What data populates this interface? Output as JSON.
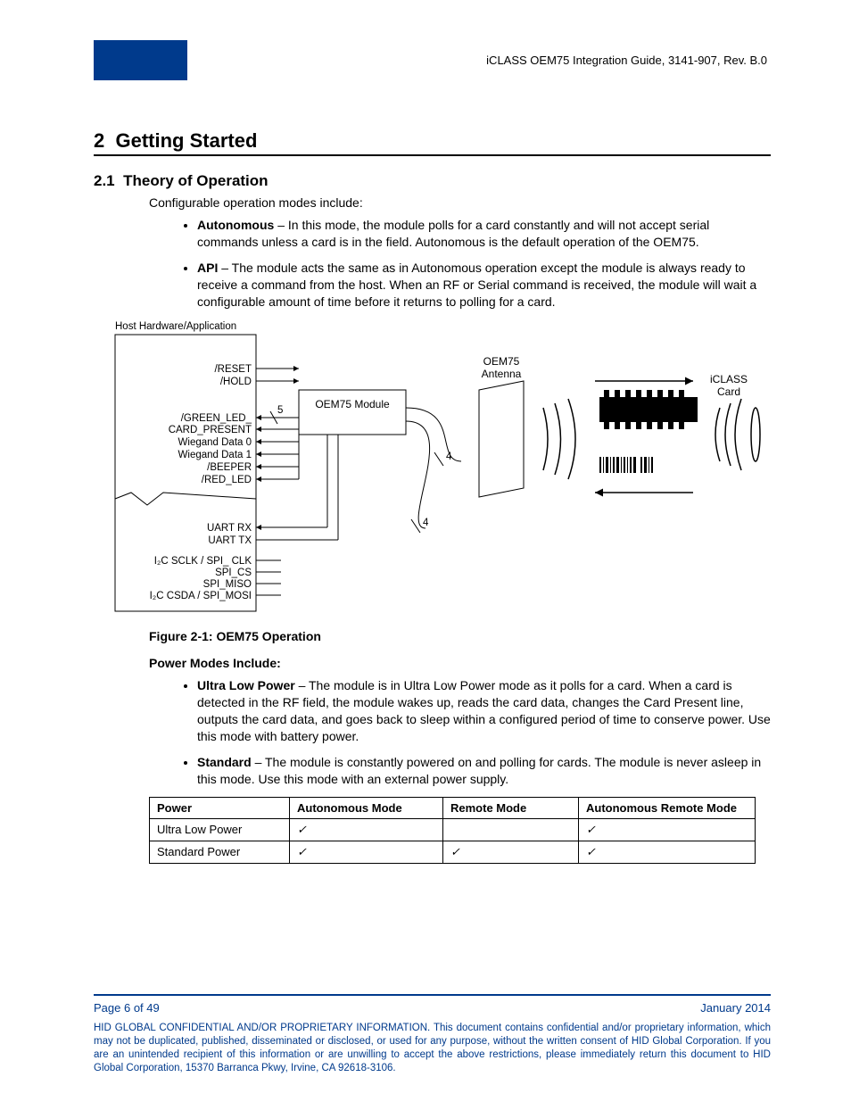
{
  "header": "iCLASS OEM75 Integration Guide, 3141-907, Rev. B.0",
  "section_number": "2",
  "section_title": "Getting Started",
  "subsection_number": "2.1",
  "subsection_title": "Theory of Operation",
  "intro": "Configurable operation modes include:",
  "modes": [
    {
      "name": "Autonomous",
      "desc": " – In this mode, the module polls for a card constantly and will not accept serial commands unless a card is in the field. Autonomous is the default operation of the OEM75."
    },
    {
      "name": "API",
      "desc": " – The module acts the same as in Autonomous operation except the module is always ready to receive a command from the host. When an RF or Serial command is received, the module will wait a configurable amount of time before it returns to polling for a card."
    }
  ],
  "diagram": {
    "host": "Host Hardware/Application",
    "module": "OEM75 Module",
    "antenna_l1": "OEM75",
    "antenna_l2": "Antenna",
    "card_l1": "iCLASS",
    "card_l2": "Card",
    "s1": "/RESET",
    "s2": "/HOLD",
    "s3": "/GREEN_LED_",
    "s4": "CARD_PRESENT",
    "s5": "Wiegand Data 0",
    "s6": "Wiegand Data 1",
    "s7": "/BEEPER",
    "s8": "/RED_LED",
    "s9": "UART RX",
    "s10": "UART TX",
    "s11": "I₂C SCLK / SPI_ CLK",
    "s12": "SPI_CS",
    "s13": "SPI_MISO",
    "s14": "I₂C CSDA / SPI_MOSI",
    "n5": "5",
    "n4a": "4",
    "n4b": "4"
  },
  "figure_caption": "Figure 2-1: OEM75 Operation",
  "power_heading": "Power Modes Include:",
  "power_modes": [
    {
      "name": "Ultra Low Power",
      "desc": " – The module is in Ultra Low Power mode as it polls for a card. When a card is detected in the RF field, the module wakes up, reads the card data, changes the Card Present line, outputs the card data, and goes back to sleep within a configured period of time to conserve power. Use this mode with battery power."
    },
    {
      "name": "Standard",
      "desc": " – The module is constantly powered on and polling for cards. The module is never asleep in this mode. Use this mode with an external power supply."
    }
  ],
  "chart_data": {
    "type": "table",
    "columns": [
      "Power",
      "Autonomous Mode",
      "Remote Mode",
      "Autonomous Remote Mode"
    ],
    "rows": [
      {
        "power": "Ultra Low Power",
        "autonomous": "✓",
        "remote": "",
        "auto_remote": "✓"
      },
      {
        "power": "Standard Power",
        "autonomous": "✓",
        "remote": "✓",
        "auto_remote": "✓"
      }
    ]
  },
  "footer": {
    "page": "Page 6 of 49",
    "date": "January 2014",
    "legal": "HID GLOBAL CONFIDENTIAL AND/OR PROPRIETARY INFORMATION. This document contains confidential and/or proprietary information, which may not be duplicated, published, disseminated or disclosed, or used for any purpose, without the written consent of HID Global Corporation. If you are an unintended recipient of this information or are unwilling to accept the above restrictions, please immediately return this document to HID Global Corporation, 15370 Barranca Pkwy, Irvine, CA 92618-3106."
  }
}
